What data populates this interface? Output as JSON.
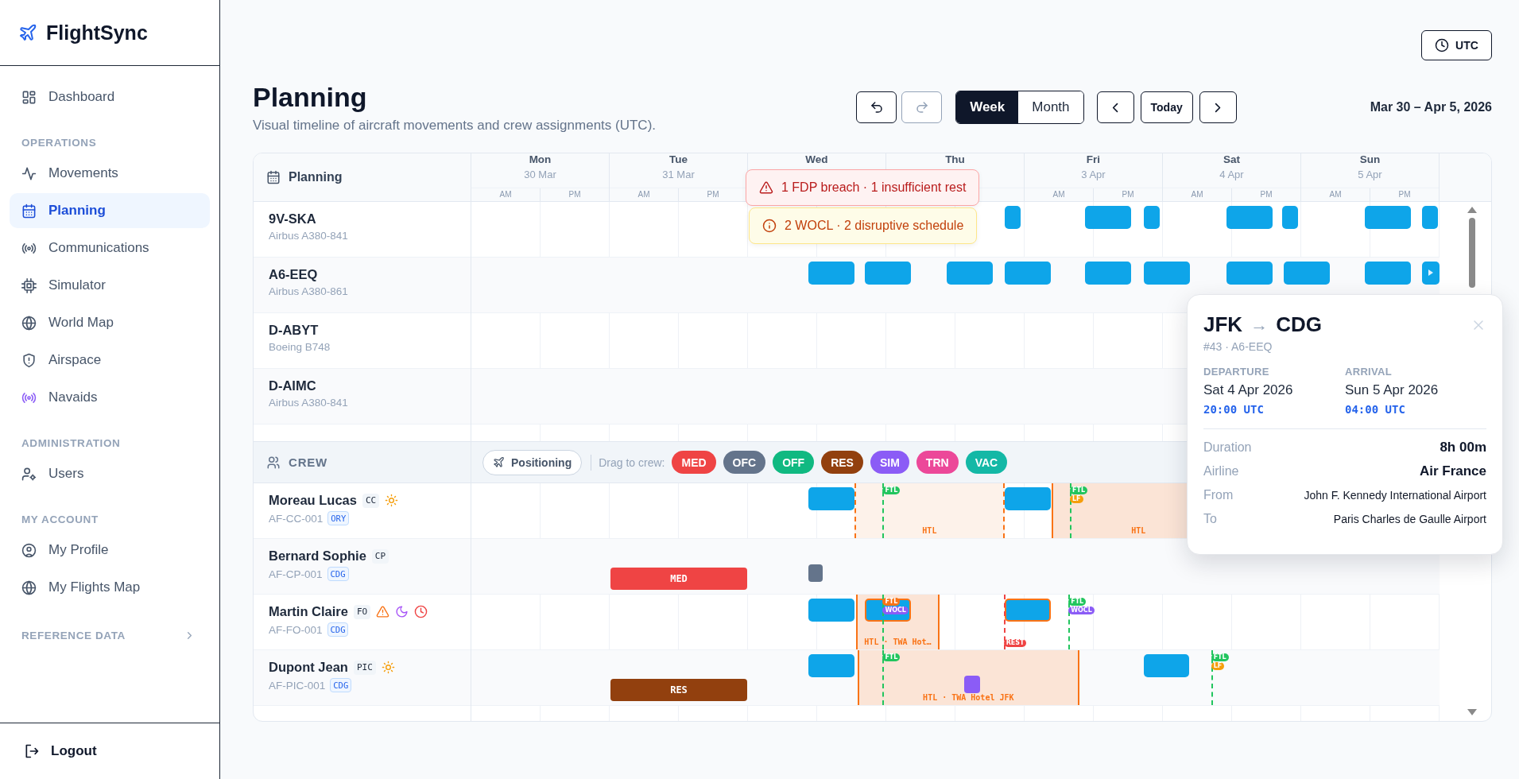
{
  "app": {
    "name": "FlightSync"
  },
  "sidebar": {
    "items": [
      {
        "kind": "link",
        "label": "Dashboard",
        "selected": false
      },
      {
        "kind": "section",
        "label": "OPERATIONS"
      },
      {
        "kind": "link",
        "label": "Movements",
        "selected": false
      },
      {
        "kind": "link",
        "label": "Planning",
        "selected": true
      },
      {
        "kind": "link",
        "label": "Communications",
        "selected": false
      },
      {
        "kind": "link",
        "label": "Simulator",
        "selected": false
      },
      {
        "kind": "link",
        "label": "World Map",
        "selected": false
      },
      {
        "kind": "link",
        "label": "Airspace",
        "selected": false
      },
      {
        "kind": "link",
        "label": "Navaids",
        "selected": false,
        "color": "#8b5cf6"
      },
      {
        "kind": "section",
        "label": "ADMINISTRATION"
      },
      {
        "kind": "link",
        "label": "Users",
        "selected": false
      },
      {
        "kind": "section",
        "label": "MY ACCOUNT"
      },
      {
        "kind": "link",
        "label": "My Profile",
        "selected": false
      },
      {
        "kind": "link",
        "label": "My Flights Map",
        "selected": false
      },
      {
        "kind": "section",
        "label": "REFERENCE DATA",
        "expanded": false
      }
    ],
    "logout": "Logout"
  },
  "timezone_button": "UTC",
  "page": {
    "title": "Planning",
    "subtitle": "Visual timeline of aircraft movements and crew assignments (UTC)."
  },
  "toolbar": {
    "undo": {
      "disabled": false
    },
    "redo": {
      "disabled": true
    },
    "views": [
      {
        "label": "Week",
        "selected": true
      },
      {
        "label": "Month",
        "selected": false
      }
    ],
    "today": "Today",
    "range": "Mar 30 – Apr 5, 2026"
  },
  "timeline": {
    "corner_label": "Planning",
    "days": [
      {
        "name": "Mon",
        "date": "30 Mar",
        "halves": [
          "AM",
          "PM"
        ]
      },
      {
        "name": "Tue",
        "date": "31 Mar",
        "halves": [
          "AM",
          "PM"
        ]
      },
      {
        "name": "Wed"
      },
      {
        "name": "Thu"
      },
      {
        "name": "Fri",
        "date": "3 Apr",
        "halves": [
          "AM",
          "PM"
        ]
      },
      {
        "name": "Sat",
        "date": "4 Apr",
        "halves": [
          "AM",
          "PM"
        ]
      },
      {
        "name": "Sun",
        "date": "5 Apr",
        "halves": [
          "AM",
          "PM"
        ]
      }
    ],
    "aircraft": [
      {
        "registration": "9V-SKA",
        "type": "Airbus A380-841",
        "flights": [
          {
            "continues": false
          },
          {
            "continues": false
          },
          {
            "continues": false
          },
          {
            "continues": false
          },
          {
            "continues": false
          },
          {
            "continues": false
          },
          {
            "continues": false
          }
        ]
      },
      {
        "registration": "A6-EEQ",
        "type": "Airbus A380-861",
        "flights": [
          {
            "continues": false
          },
          {
            "continues": false
          },
          {
            "continues": false
          },
          {
            "continues": false
          },
          {
            "continues": false
          },
          {
            "continues": false
          },
          {
            "continues": false
          },
          {
            "continues": false
          },
          {
            "continues": false
          },
          {
            "continues": true
          }
        ]
      },
      {
        "registration": "D-ABYT",
        "type": "Boeing B748"
      },
      {
        "registration": "D-AIMC",
        "type": "Airbus A380-841"
      }
    ],
    "crew_label": "CREW",
    "positioning": "Positioning",
    "drag_label": "Drag to crew:",
    "chips": [
      {
        "label": "MED",
        "color": "#ef4444"
      },
      {
        "label": "OFC",
        "color": "#64748b"
      },
      {
        "label": "OFF",
        "color": "#10b981"
      },
      {
        "label": "RES",
        "color": "#92400e"
      },
      {
        "label": "SIM",
        "color": "#8b5cf6"
      },
      {
        "label": "TRN",
        "color": "#ec4899"
      },
      {
        "label": "VAC",
        "color": "#14b8a6"
      }
    ],
    "crew": [
      {
        "name": "Moreau Lucas",
        "role": "CC",
        "day_duty": true,
        "fatigue": false,
        "night": false,
        "rest_alert": false,
        "id": "AF-CC-001",
        "base": "ORY",
        "events": [
          {
            "kind": "flight",
            "flagged": false
          },
          {
            "kind": "marker",
            "color": "#22c55e",
            "tags": [
              {
                "text": "FTL",
                "color": "#22c55e"
              }
            ]
          },
          {
            "kind": "flight",
            "flagged": false
          },
          {
            "kind": "marker",
            "color": "#22c55e",
            "tags": [
              {
                "text": "FTL",
                "color": "#22c55e"
              },
              {
                "text": "LF",
                "color": "#f59e0b"
              }
            ]
          },
          {
            "kind": "rest",
            "dashed": true,
            "label": "HTL"
          },
          {
            "kind": "rest",
            "dashed": false,
            "label": "HTL"
          }
        ]
      },
      {
        "name": "Bernard Sophie",
        "role": "CP",
        "day_duty": false,
        "fatigue": false,
        "night": false,
        "rest_alert": false,
        "id": "AF-CP-001",
        "base": "CDG",
        "events": [
          {
            "kind": "duty",
            "label": "MED",
            "color": "#ef4444"
          },
          {
            "kind": "block",
            "color": "#64748b"
          }
        ]
      },
      {
        "name": "Martin Claire",
        "role": "FO",
        "day_duty": false,
        "fatigue": true,
        "night": true,
        "rest_alert": true,
        "id": "AF-FO-001",
        "base": "CDG",
        "events": [
          {
            "kind": "flight",
            "flagged": false
          },
          {
            "kind": "flight",
            "flagged": true
          },
          {
            "kind": "marker",
            "color": "#22c55e",
            "tags": [
              {
                "text": "FTL",
                "color": "#f97316"
              },
              {
                "text": "WOCL",
                "color": "#8b5cf6"
              }
            ]
          },
          {
            "kind": "flight",
            "flagged": true
          },
          {
            "kind": "marker",
            "color": "#22c55e",
            "tags": [
              {
                "text": "FTL",
                "color": "#22c55e"
              },
              {
                "text": "WOCL",
                "color": "#8b5cf6"
              }
            ]
          },
          {
            "kind": "rest",
            "dashed": false,
            "label": "HTL · TWA Hot…"
          },
          {
            "kind": "marker",
            "color": "#ef4444",
            "tags": [
              {
                "text": "REST",
                "color": "#ef4444"
              }
            ]
          }
        ]
      },
      {
        "name": "Dupont Jean",
        "role": "PIC",
        "day_duty": true,
        "fatigue": false,
        "night": false,
        "rest_alert": false,
        "id": "AF-PIC-001",
        "base": "CDG",
        "events": [
          {
            "kind": "flight",
            "flagged": false
          },
          {
            "kind": "marker",
            "color": "#22c55e",
            "tags": [
              {
                "text": "FTL",
                "color": "#22c55e"
              }
            ]
          },
          {
            "kind": "flight",
            "flagged": false
          },
          {
            "kind": "marker",
            "color": "#22c55e",
            "tags": [
              {
                "text": "FTL",
                "color": "#22c55e"
              },
              {
                "text": "LF",
                "color": "#f59e0b"
              }
            ]
          },
          {
            "kind": "duty",
            "label": "RES",
            "color": "#92400e"
          },
          {
            "kind": "block",
            "color": "#8b5cf6"
          },
          {
            "kind": "rest",
            "dashed": false,
            "label": "HTL · TWA Hotel JFK"
          }
        ]
      }
    ]
  },
  "alerts": [
    {
      "kind": "error",
      "text": "1 FDP breach · 1 insufficient rest"
    },
    {
      "kind": "warning",
      "text": "2 WOCL · 2 disruptive schedule"
    }
  ],
  "flight_popup": {
    "from": "JFK",
    "separator": "→",
    "to": "CDG",
    "subtitle": "#43 · A6-EEQ",
    "departure": {
      "label": "DEPARTURE",
      "date": "Sat 4 Apr 2026",
      "time": "20:00 UTC"
    },
    "arrival": {
      "label": "ARRIVAL",
      "date": "Sun 5 Apr 2026",
      "time": "04:00 UTC"
    },
    "details": [
      {
        "label": "Duration",
        "value": "8h 00m",
        "emphasis": true
      },
      {
        "label": "Airline",
        "value": "Air France",
        "emphasis": true
      },
      {
        "label": "From",
        "value": "John F. Kennedy International Airport",
        "emphasis": false
      },
      {
        "label": "To",
        "value": "Paris Charles de Gaulle Airport",
        "emphasis": false
      }
    ]
  }
}
